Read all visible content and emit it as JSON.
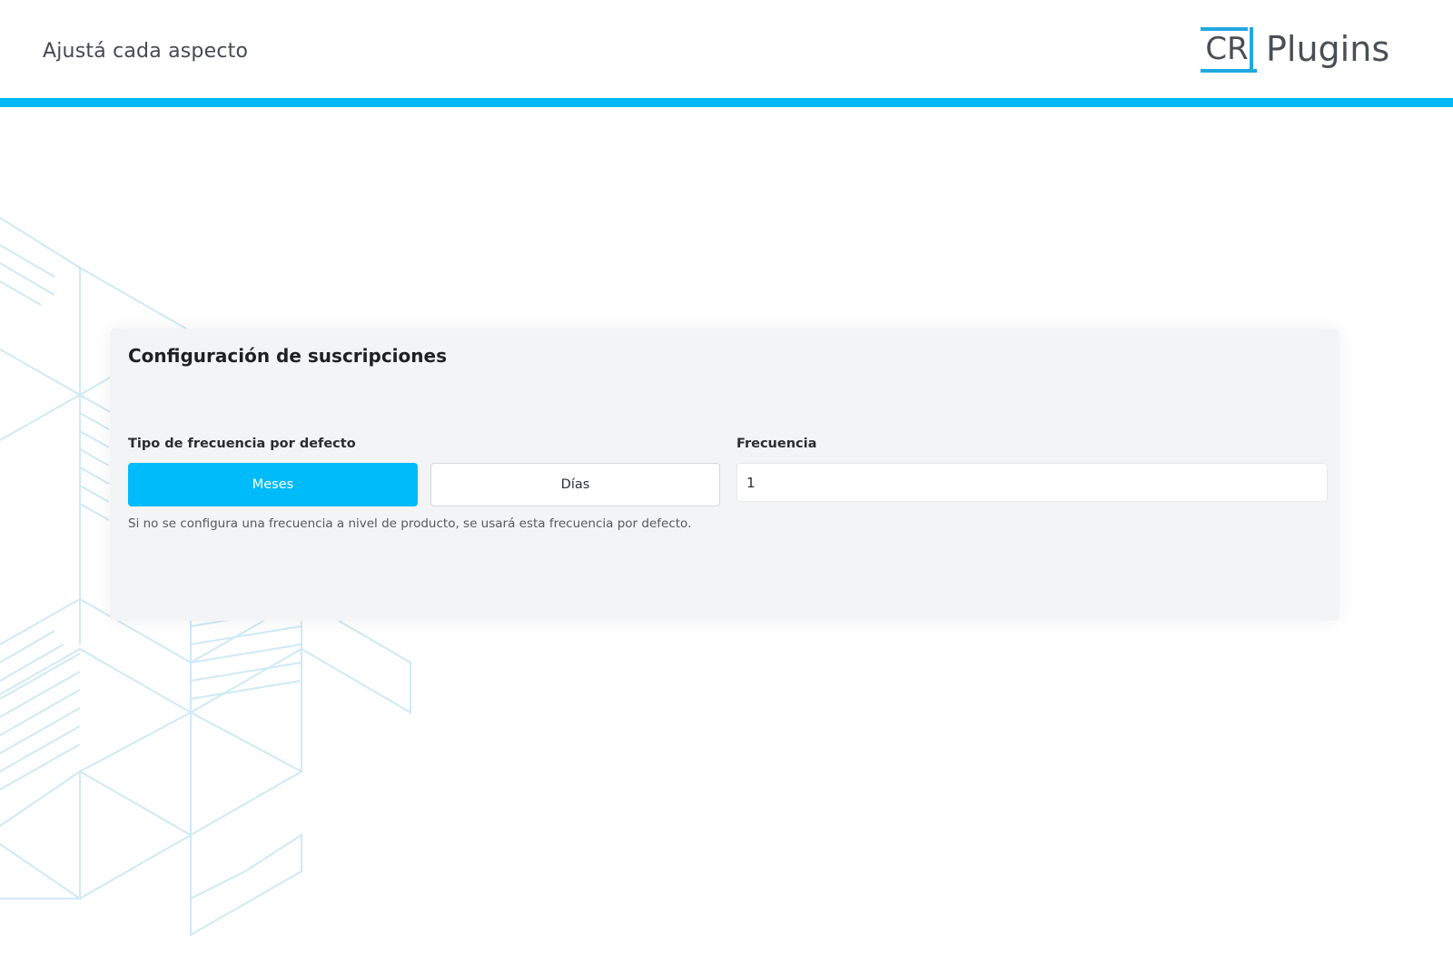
{
  "header": {
    "title": "Ajustá cada aspecto",
    "logo_mark": "CR",
    "logo_text": "Plugins"
  },
  "colors": {
    "accent": "#00b8f5",
    "primary_button": "#00bbfa",
    "card_background": "#f3f4f5",
    "pattern_line": "#cfe9f6"
  },
  "settings_card": {
    "title": "Configuración de suscripciones",
    "frequency_type": {
      "label": "Tipo de frecuencia por defecto",
      "options": [
        {
          "label": "Meses",
          "selected": true
        },
        {
          "label": "Días",
          "selected": false
        }
      ],
      "help": "Si no se configura una frecuencia a nivel de producto, se usará esta frecuencia por defecto."
    },
    "frequency": {
      "label": "Frecuencia",
      "value": "1"
    }
  }
}
